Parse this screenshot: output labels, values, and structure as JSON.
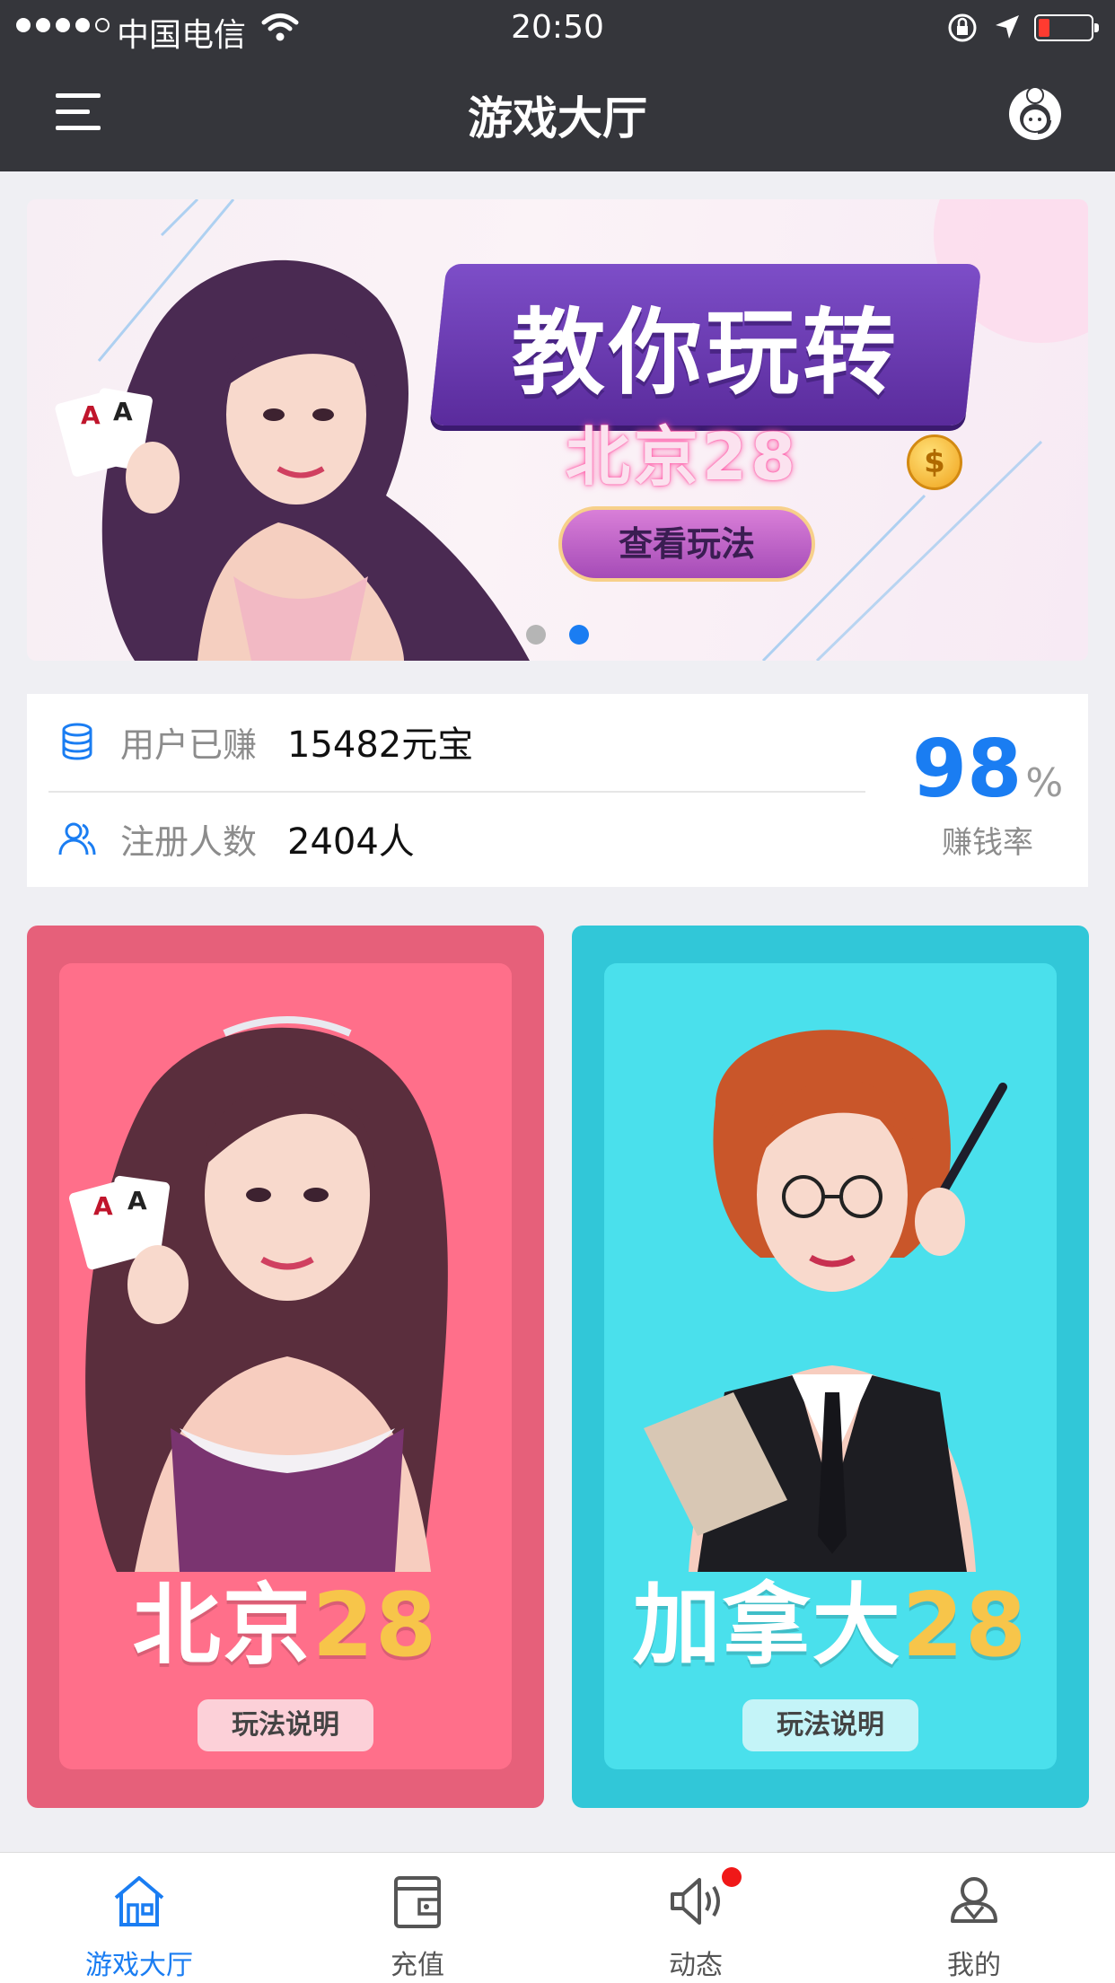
{
  "status_bar": {
    "carrier": "中国电信",
    "time": "20:50"
  },
  "nav": {
    "title": "游戏大厅",
    "menu_icon": "menu-icon",
    "service_icon": "customer-service-icon"
  },
  "banner": {
    "title": "教你玩转",
    "subtitle": "北京28",
    "button": "查看玩法",
    "coin_symbol": "$",
    "active_page": 2,
    "page_count": 2
  },
  "stats": {
    "earned_label": "用户已赚",
    "earned_value": "15482元宝",
    "registered_label": "注册人数",
    "registered_value": "2404人",
    "rate_value": "98",
    "rate_unit": "%",
    "rate_label": "赚钱率"
  },
  "games": [
    {
      "name_cn": "北京",
      "name_num": "28",
      "help": "玩法说明",
      "color": "#e6607a"
    },
    {
      "name_cn": "加拿大",
      "name_num": "28",
      "help": "玩法说明",
      "color": "#31c7d8"
    }
  ],
  "tabs": [
    {
      "label": "游戏大厅",
      "icon": "home-icon",
      "active": true
    },
    {
      "label": "充值",
      "icon": "wallet-icon",
      "active": false
    },
    {
      "label": "动态",
      "icon": "speaker-icon",
      "active": false,
      "badge": true
    },
    {
      "label": "我的",
      "icon": "user-icon",
      "active": false
    }
  ],
  "colors": {
    "accent": "#1a7df2",
    "nav_bg": "#35363b",
    "badge": "#f01818"
  }
}
